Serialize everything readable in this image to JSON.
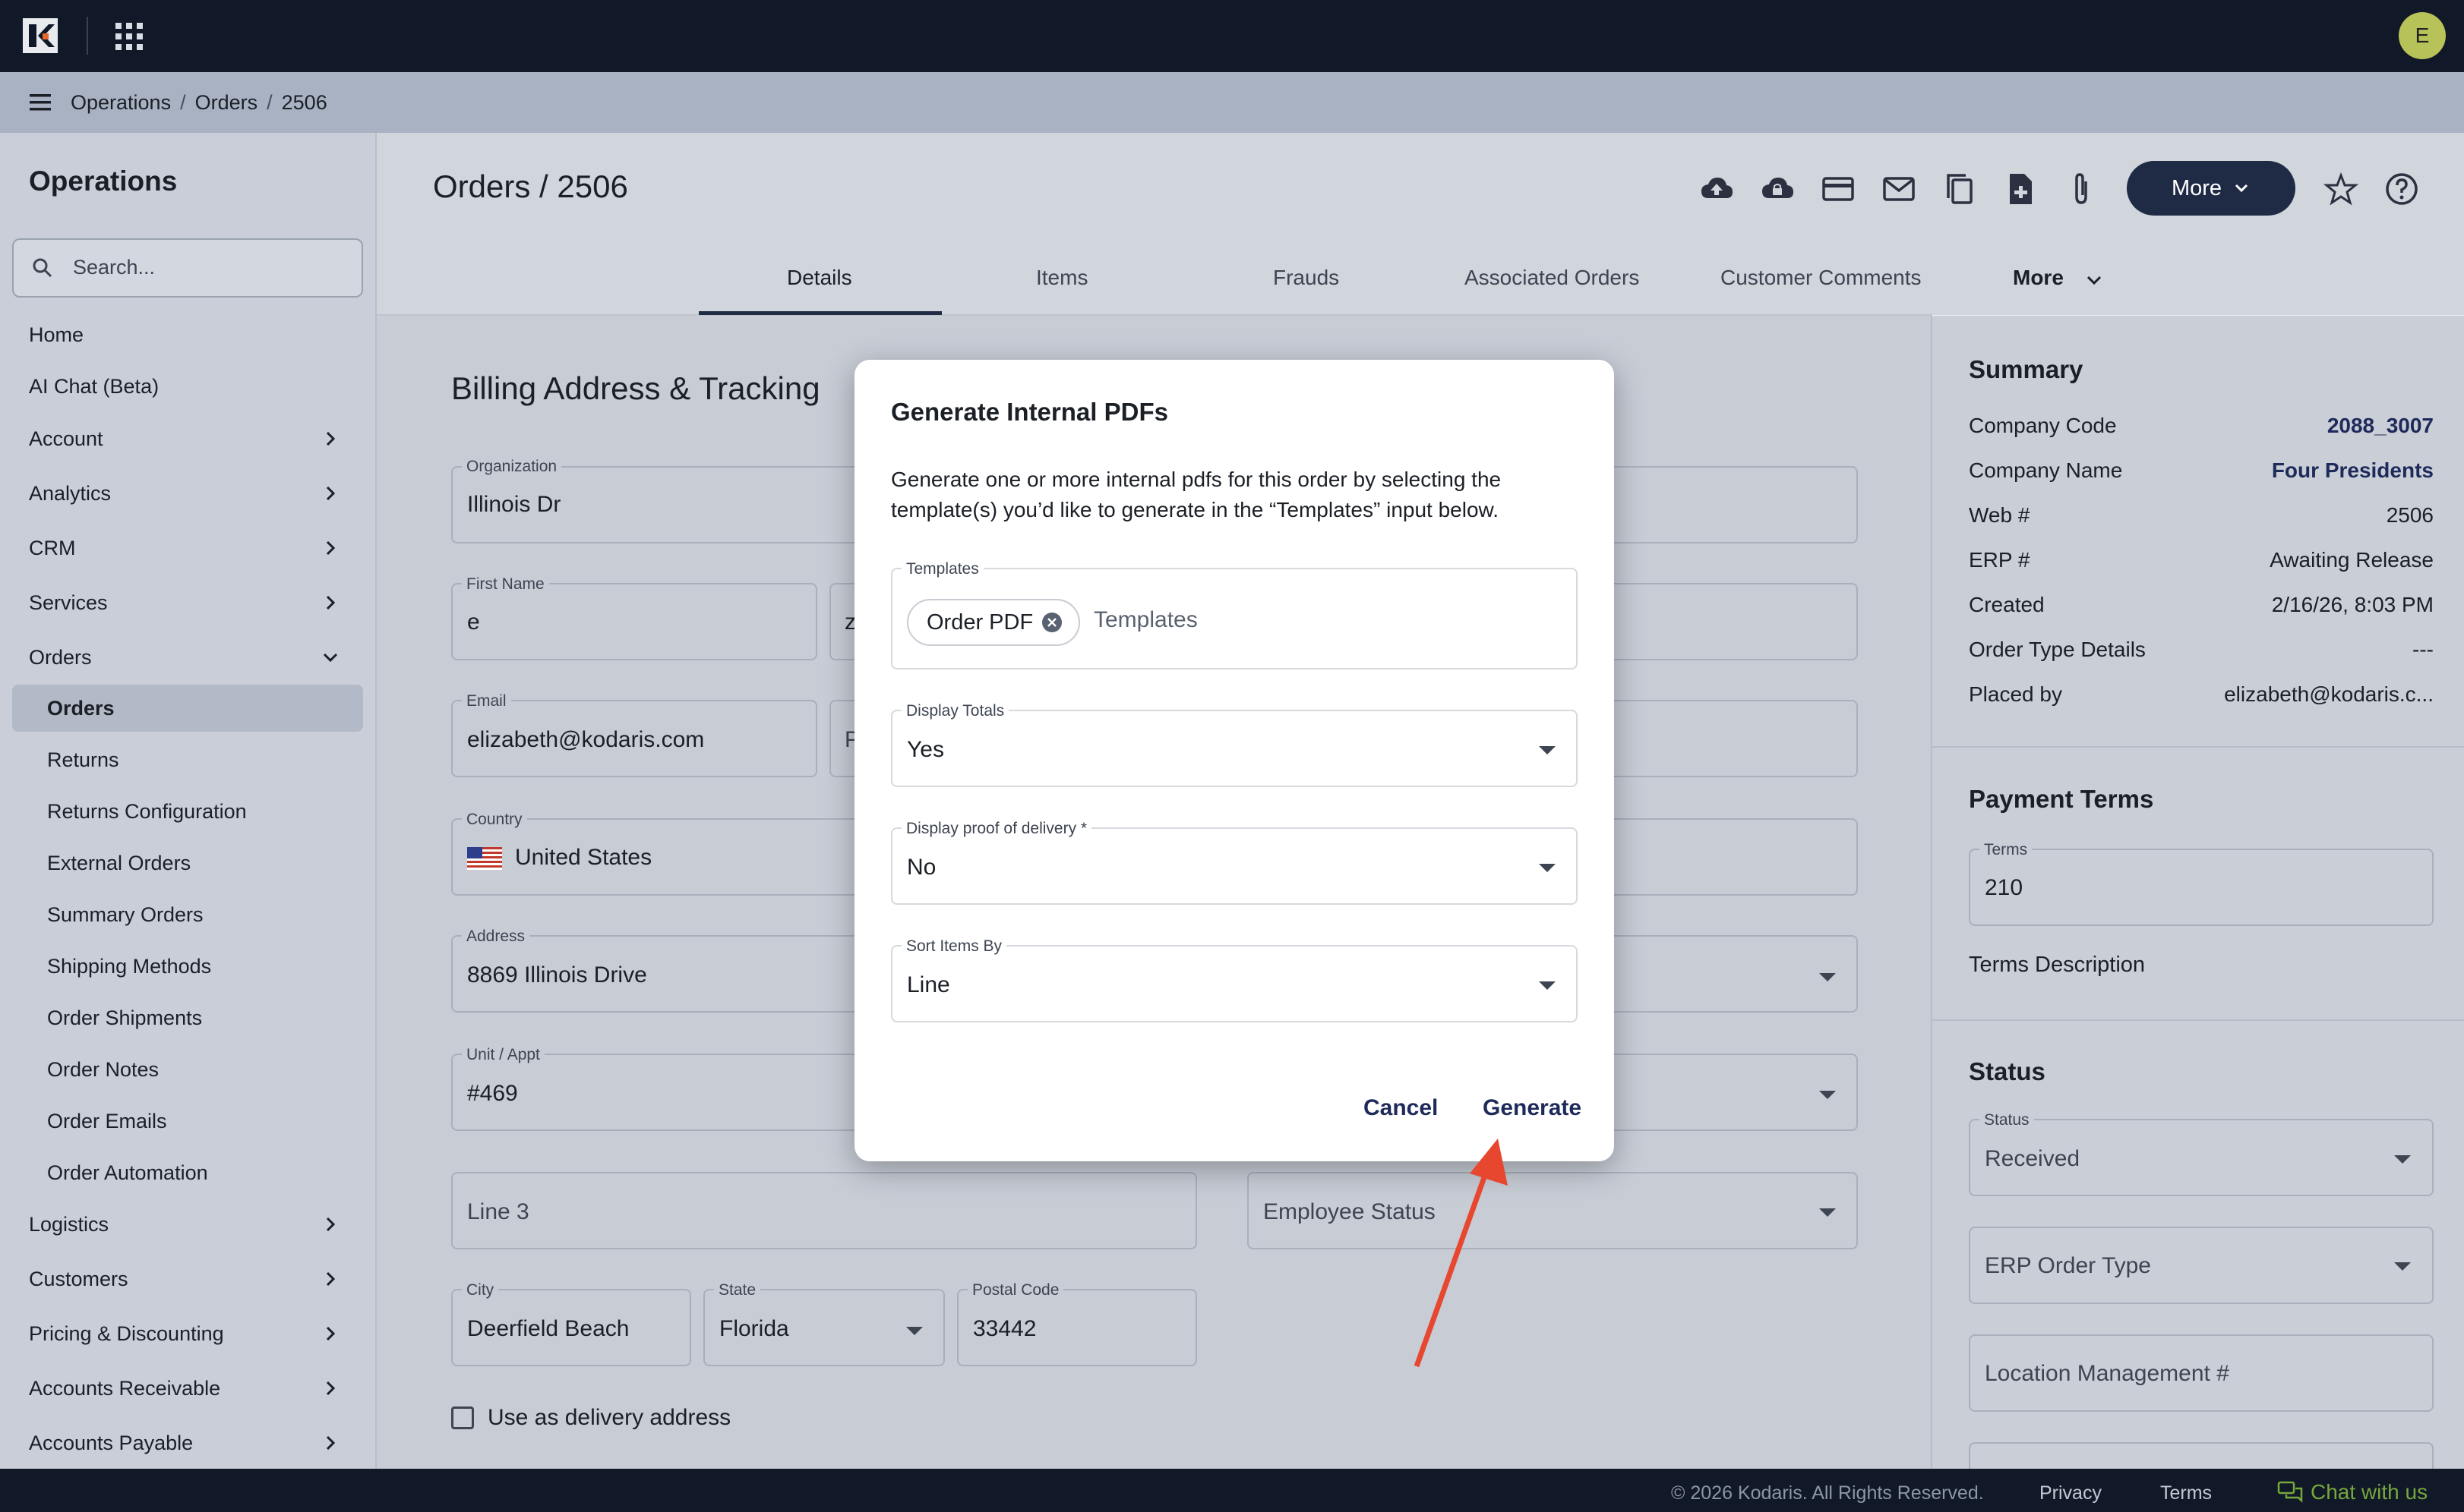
{
  "topbar": {
    "avatar_initial": "E"
  },
  "breadcrumb": [
    "Operations",
    "Orders",
    "2506"
  ],
  "breadcrumb_sep": "/",
  "sidebar": {
    "title": "Operations",
    "search_placeholder": "Search...",
    "items": [
      {
        "label": "Home",
        "expandable": false
      },
      {
        "label": "AI Chat (Beta)",
        "expandable": false
      },
      {
        "label": "Account",
        "expandable": true
      },
      {
        "label": "Analytics",
        "expandable": true
      },
      {
        "label": "CRM",
        "expandable": true
      },
      {
        "label": "Services",
        "expandable": true
      },
      {
        "label": "Orders",
        "expandable": true,
        "expanded": true
      }
    ],
    "order_subitems": [
      "Orders",
      "Returns",
      "Returns Configuration",
      "External Orders",
      "Summary Orders",
      "Shipping Methods",
      "Order Shipments",
      "Order Notes",
      "Order Emails",
      "Order Automation"
    ],
    "items_after": [
      "Logistics",
      "Customers",
      "Pricing & Discounting",
      "Accounts Receivable",
      "Accounts Payable"
    ]
  },
  "page": {
    "title": "Orders / 2506",
    "more_button": "More",
    "tabs": [
      "Details",
      "Items",
      "Frauds",
      "Associated Orders",
      "Customer Comments",
      "More"
    ],
    "active_tab": "Details"
  },
  "billing": {
    "title": "Billing Address & Tracking",
    "organization_label": "Organization",
    "organization": "Illinois Dr",
    "first_name_label": "First Name",
    "first_name": "e",
    "last_name_partial": "z",
    "email_label": "Email",
    "email": "elizabeth@kodaris.com",
    "phone_partial": "P",
    "country_label": "Country",
    "country": "United States",
    "address_label": "Address",
    "address": "8869 Illinois Drive",
    "unit_label": "Unit / Appt",
    "unit": "#469",
    "line3_placeholder": "Line 3",
    "employee_status_placeholder": "Employee Status",
    "city_label": "City",
    "city": "Deerfield Beach",
    "state_label": "State",
    "state": "Florida",
    "postal_label": "Postal Code",
    "postal": "33442",
    "delivery_checkbox": "Use as delivery address"
  },
  "summary": {
    "title": "Summary",
    "rows": [
      {
        "key": "Company Code",
        "value": "2088_3007",
        "link": true
      },
      {
        "key": "Company Name",
        "value": "Four Presidents",
        "link": true
      },
      {
        "key": "Web #",
        "value": "2506",
        "link": false
      },
      {
        "key": "ERP #",
        "value": "Awaiting Release",
        "link": false
      },
      {
        "key": "Created",
        "value": "2/16/26, 8:03 PM",
        "link": false
      },
      {
        "key": "Order Type Details",
        "value": "---",
        "link": false
      },
      {
        "key": "Placed by",
        "value": "elizabeth@kodaris.c...",
        "link": false
      }
    ]
  },
  "payment_terms": {
    "title": "Payment Terms",
    "terms_label": "Terms",
    "terms": "210",
    "terms_description": "Terms Description"
  },
  "status": {
    "title": "Status",
    "status_label": "Status",
    "status": "Received",
    "erp_order_type_placeholder": "ERP Order Type",
    "location_placeholder": "Location Management #"
  },
  "modal": {
    "title": "Generate Internal PDFs",
    "description": "Generate one or more internal pdfs for this order by selecting the template(s) you’d like to generate in the “Templates” input below.",
    "templates_label": "Templates",
    "templates_chip": "Order PDF",
    "templates_placeholder": "Templates",
    "display_totals_label": "Display Totals",
    "display_totals": "Yes",
    "proof_label": "Display proof of delivery *",
    "proof": "No",
    "sort_label": "Sort Items By",
    "sort": "Line",
    "cancel": "Cancel",
    "generate": "Generate"
  },
  "footer": {
    "copyright": "© 2026 Kodaris. All Rights Reserved.",
    "privacy": "Privacy",
    "terms": "Terms",
    "chat": "Chat with us"
  },
  "colors": {
    "topbar": "#111827",
    "accent": "#1f2a44",
    "arrow": "#e8472f",
    "chat": "#76a83d",
    "avatar": "#b7c259"
  }
}
